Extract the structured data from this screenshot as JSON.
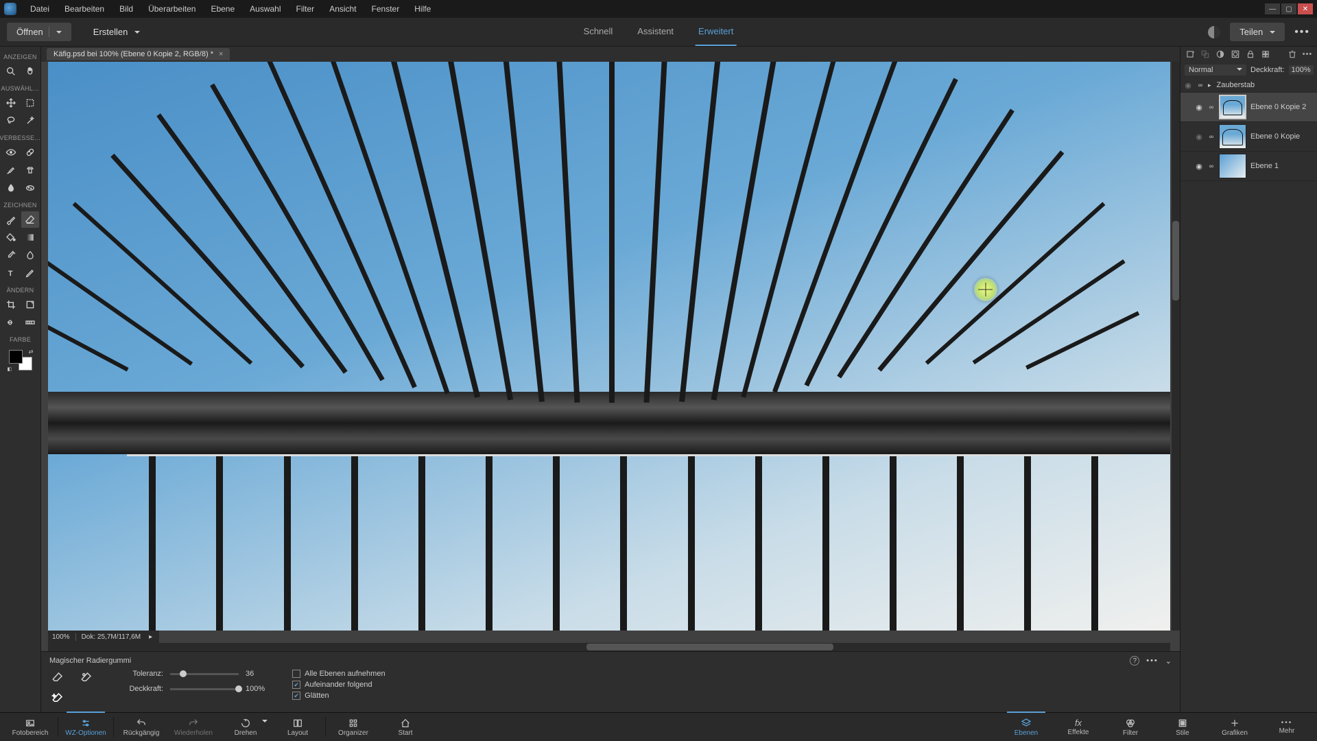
{
  "menus": [
    "Datei",
    "Bearbeiten",
    "Bild",
    "Überarbeiten",
    "Ebene",
    "Auswahl",
    "Filter",
    "Ansicht",
    "Fenster",
    "Hilfe"
  ],
  "toolbar": {
    "open": "Öffnen",
    "create": "Erstellen",
    "modes": {
      "quick": "Schnell",
      "assist": "Assistent",
      "advanced": "Erweitert"
    },
    "share": "Teilen"
  },
  "document": {
    "tab_title": "Käfig.psd bei 100% (Ebene 0 Kopie 2, RGB/8) *",
    "zoom": "100%",
    "doc_size": "Dok: 25,7M/117,6M"
  },
  "tool_sections": {
    "anzeigen": "ANZEIGEN",
    "auswahl": "AUSWÄHL…",
    "verbessern": "VERBESSE…",
    "zeichnen": "ZEICHNEN",
    "aendern": "ÄNDERN",
    "farbe": "FARBE"
  },
  "tool_options": {
    "tool_name": "Magischer Radiergummi",
    "tolerance_label": "Toleranz:",
    "tolerance_value": "36",
    "opacity_label": "Deckkraft:",
    "opacity_value": "100%",
    "chk_all_layers": "Alle Ebenen aufnehmen",
    "chk_contiguous": "Aufeinander folgend",
    "chk_antialias": "Glätten"
  },
  "layers_panel": {
    "blend_mode": "Normal",
    "opacity_label": "Deckkraft:",
    "opacity_value": "100%",
    "group_name": "Zauberstab",
    "layers": [
      {
        "name": "Ebene 0 Kopie 2",
        "selected": true,
        "thumb": "cage"
      },
      {
        "name": "Ebene 0 Kopie",
        "selected": false,
        "thumb": "cage"
      },
      {
        "name": "Ebene 1",
        "selected": false,
        "thumb": "grad"
      }
    ]
  },
  "bottom_left": [
    {
      "label": "Fotobereich",
      "icon": "photo"
    },
    {
      "label": "WZ-Optionen",
      "icon": "sliders",
      "active": true
    },
    {
      "label": "Rückgängig",
      "icon": "undo"
    },
    {
      "label": "Wiederholen",
      "icon": "redo"
    },
    {
      "label": "Drehen",
      "icon": "rotate"
    },
    {
      "label": "Layout",
      "icon": "layout"
    },
    {
      "label": "Organizer",
      "icon": "organizer"
    },
    {
      "label": "Start",
      "icon": "home"
    }
  ],
  "bottom_right": [
    {
      "label": "Ebenen",
      "icon": "layers",
      "active": true
    },
    {
      "label": "Effekte",
      "icon": "fx"
    },
    {
      "label": "Filter",
      "icon": "filter"
    },
    {
      "label": "Stile",
      "icon": "styles"
    },
    {
      "label": "Grafiken",
      "icon": "plus"
    },
    {
      "label": "Mehr",
      "icon": "more"
    }
  ]
}
